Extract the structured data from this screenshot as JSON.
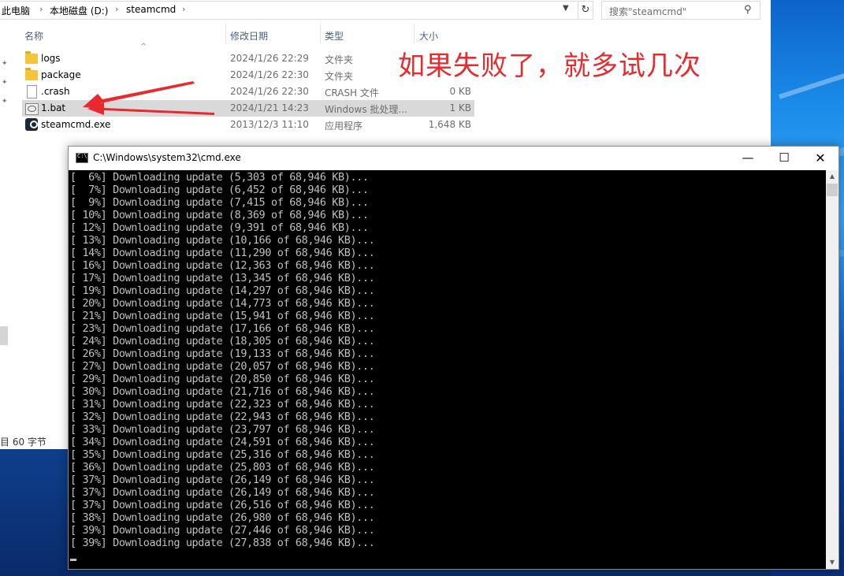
{
  "explorer": {
    "breadcrumb": [
      "此电脑",
      "本地磁盘 (D:)",
      "steamcmd"
    ],
    "search_placeholder": "搜索\"steamcmd\"",
    "columns": {
      "name": "名称",
      "date": "修改日期",
      "type": "类型",
      "size": "大小"
    },
    "files": [
      {
        "name": "logs",
        "date": "2024/1/26 22:29",
        "type": "文件夹",
        "size": "",
        "icon": "folder-icon"
      },
      {
        "name": "package",
        "date": "2024/1/26 22:30",
        "type": "文件夹",
        "size": "",
        "icon": "folder-icon"
      },
      {
        "name": ".crash",
        "date": "2024/1/26 22:30",
        "type": "CRASH 文件",
        "size": "0 KB",
        "icon": "file-icon"
      },
      {
        "name": "1.bat",
        "date": "2024/1/21 14:23",
        "type": "Windows 批处理...",
        "size": "1 KB",
        "icon": "batch-file-icon",
        "selected": true
      },
      {
        "name": "steamcmd.exe",
        "date": "2013/12/3 11:10",
        "type": "应用程序",
        "size": "1,648 KB",
        "icon": "steam-icon"
      }
    ],
    "status": "目 60 字节"
  },
  "annotation": "如果失败了，就多试几次",
  "annotation_color": "#e8292e",
  "cmd": {
    "title": "C:\\Windows\\system32\\cmd.exe",
    "lines": [
      "[  6%] Downloading update (5,303 of 68,946 KB)...",
      "[  7%] Downloading update (6,452 of 68,946 KB)...",
      "[  9%] Downloading update (7,415 of 68,946 KB)...",
      "[ 10%] Downloading update (8,369 of 68,946 KB)...",
      "[ 12%] Downloading update (9,391 of 68,946 KB)...",
      "[ 13%] Downloading update (10,166 of 68,946 KB)...",
      "[ 14%] Downloading update (11,290 of 68,946 KB)...",
      "[ 16%] Downloading update (12,363 of 68,946 KB)...",
      "[ 17%] Downloading update (13,345 of 68,946 KB)...",
      "[ 19%] Downloading update (14,297 of 68,946 KB)...",
      "[ 20%] Downloading update (14,773 of 68,946 KB)...",
      "[ 21%] Downloading update (15,941 of 68,946 KB)...",
      "[ 23%] Downloading update (17,166 of 68,946 KB)...",
      "[ 24%] Downloading update (18,305 of 68,946 KB)...",
      "[ 26%] Downloading update (19,133 of 68,946 KB)...",
      "[ 27%] Downloading update (20,057 of 68,946 KB)...",
      "[ 29%] Downloading update (20,850 of 68,946 KB)...",
      "[ 30%] Downloading update (21,716 of 68,946 KB)...",
      "[ 31%] Downloading update (22,323 of 68,946 KB)...",
      "[ 32%] Downloading update (22,943 of 68,946 KB)...",
      "[ 33%] Downloading update (23,797 of 68,946 KB)...",
      "[ 34%] Downloading update (24,591 of 68,946 KB)...",
      "[ 35%] Downloading update (25,316 of 68,946 KB)...",
      "[ 36%] Downloading update (25,803 of 68,946 KB)...",
      "[ 37%] Downloading update (26,149 of 68,946 KB)...",
      "[ 37%] Downloading update (26,149 of 68,946 KB)...",
      "[ 37%] Downloading update (26,516 of 68,946 KB)...",
      "[ 38%] Downloading update (26,980 of 68,946 KB)...",
      "[ 39%] Downloading update (27,446 of 68,946 KB)...",
      "[ 39%] Downloading update (27,838 of 68,946 KB)..."
    ]
  }
}
